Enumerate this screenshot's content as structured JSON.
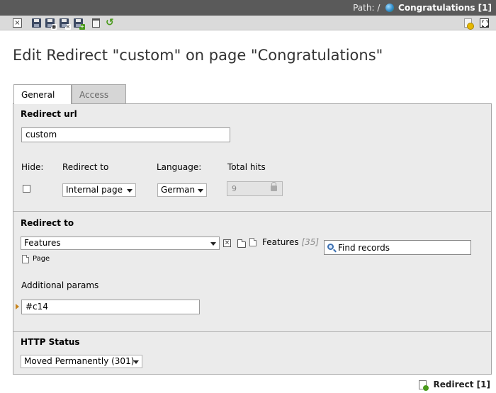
{
  "pathbar": {
    "label": "Path: /",
    "page": "Congratulations [1]"
  },
  "toolbar": {
    "close_icon": "close-document-icon",
    "save_icon": "save-icon",
    "save_view_icon": "save-and-view-icon",
    "save_close_icon": "save-and-close-icon",
    "save_new_icon": "save-and-new-icon",
    "delete_icon": "trash-icon",
    "undo_icon": "undo-icon",
    "new_record_icon": "new-record-icon",
    "fullscreen_icon": "fullscreen-icon"
  },
  "header": {
    "title": "Edit Redirect \"custom\" on page \"Congratulations\""
  },
  "tabs": [
    {
      "label": "General",
      "active": true
    },
    {
      "label": "Access",
      "active": false
    }
  ],
  "general": {
    "redirect_url_label": "Redirect url",
    "redirect_url_value": "custom",
    "hide_label": "Hide:",
    "hide_checked": false,
    "redirect_to_label": "Redirect to",
    "redirect_to_value": "Internal page",
    "language_label": "Language:",
    "language_value": "German",
    "total_hits_label": "Total hits",
    "total_hits_value": "9"
  },
  "redirect_target": {
    "section_label": "Redirect to",
    "selected_value": "Features",
    "record_title": "Features",
    "record_uid": "[35]",
    "find_placeholder": "Find records",
    "table_label": "Page",
    "additional_params_label": "Additional params",
    "additional_params_value": "#c14"
  },
  "http_status": {
    "label": "HTTP Status",
    "value": "Moved Permanently (301)"
  },
  "footer": {
    "record_label": "Redirect [1]"
  },
  "colors": {
    "pathbar_bg": "#5a5a5a",
    "toolbar_bg": "#dadada",
    "panel_bg": "#ebebeb",
    "accent_pointer": "#c8841c"
  }
}
